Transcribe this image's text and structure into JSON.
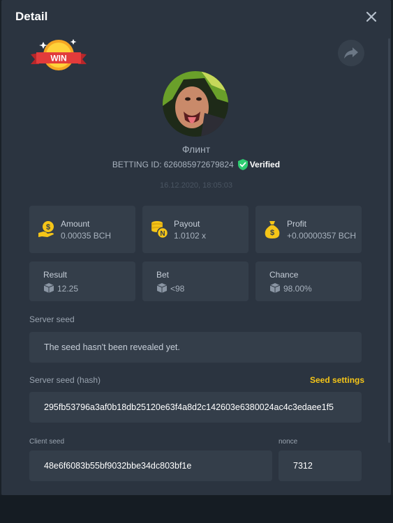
{
  "modal": {
    "title": "Detail"
  },
  "badge": {
    "text": "WIN"
  },
  "player": {
    "name": "Флинт",
    "betting_id_label": "BETTING ID:",
    "betting_id": "626085972679824",
    "verified_label": "Verified",
    "date": "16.12.2020, 18:05:03"
  },
  "stats": {
    "amount": {
      "label": "Amount",
      "value": "0.00035 BCH"
    },
    "payout": {
      "label": "Payout",
      "value": "1.0102 x"
    },
    "profit": {
      "label": "Profit",
      "value": "+0.00000357 BCH"
    },
    "result": {
      "label": "Result",
      "value": "12.25"
    },
    "bet": {
      "label": "Bet",
      "value": "<98"
    },
    "chance": {
      "label": "Chance",
      "value": "98.00%"
    }
  },
  "seeds": {
    "server_seed_label": "Server seed",
    "server_seed_value": "The seed hasn't been revealed yet.",
    "server_seed_hash_label": "Server seed (hash)",
    "seed_settings_label": "Seed settings",
    "server_seed_hash": "295fb53796a3af0b18db25120e63f4a8d2c142603e6380024ac4c3edaee1f5",
    "client_seed_label": "Client seed",
    "client_seed": "48e6f6083b55bf9032bbe34dc803bf1e",
    "nonce_label": "nonce",
    "nonce": "7312"
  },
  "colors": {
    "accent": "#f5c518",
    "verified_green": "#2ecc71",
    "panel": "#2b3440",
    "card": "#343e4a"
  },
  "icons": [
    "close-icon",
    "share-icon",
    "verified-shield-icon",
    "money-hand-icon",
    "coin-stack-icon",
    "money-bag-icon",
    "dice-icon"
  ]
}
